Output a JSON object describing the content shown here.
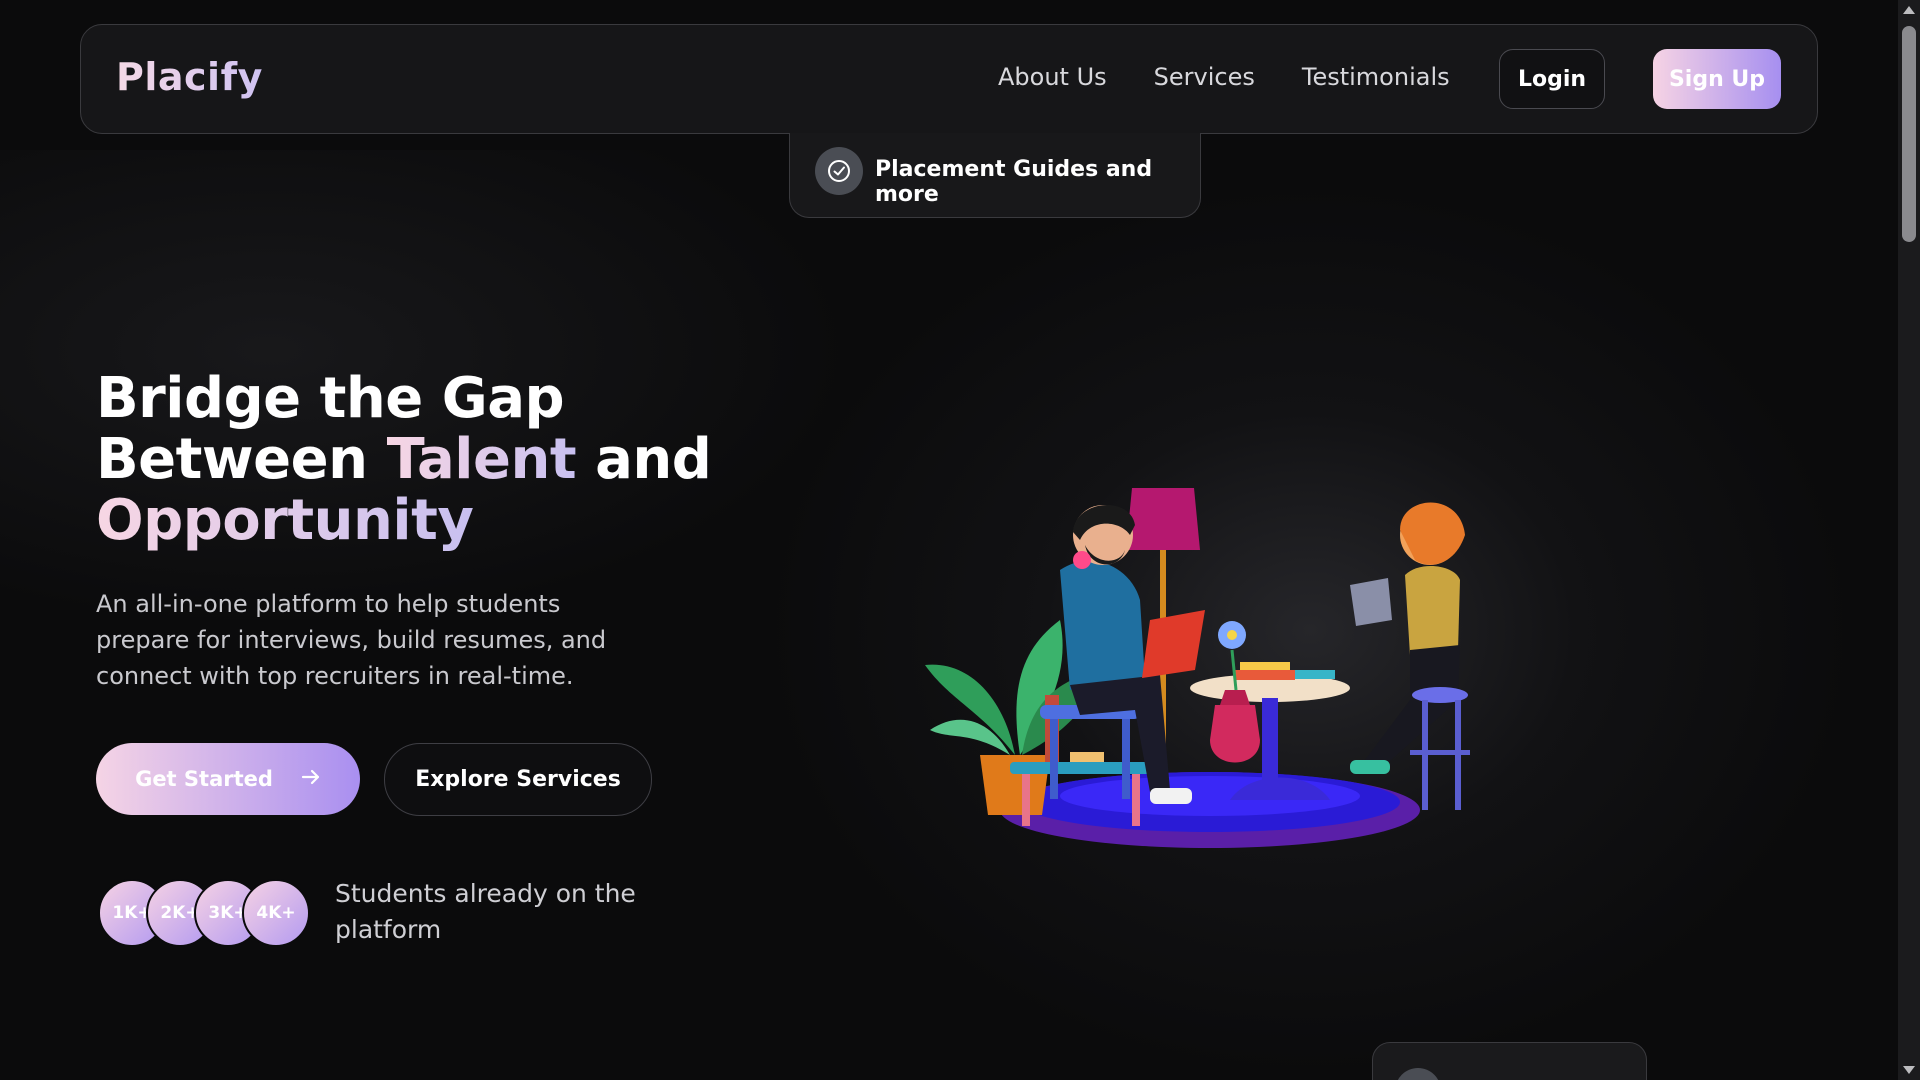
{
  "nav": {
    "brand": "Placify",
    "links": [
      "About Us",
      "Services",
      "Testimonials"
    ],
    "login_label": "Login",
    "signup_label": "Sign Up"
  },
  "badge": {
    "icon": "check-circle-icon",
    "text": "Placement Guides and more"
  },
  "hero": {
    "title_line1": "Bridge the Gap",
    "title_line2_part1": "Between ",
    "title_line2_highlight": "Talent",
    "title_line2_part2": " and",
    "title_line3_highlight": "Opportunity",
    "description": "An all-in-one platform to help students prepare for interviews, build resumes, and connect with top recruiters in real-time.",
    "primary_cta": "Get Started",
    "primary_cta_icon": "arrow-right-icon",
    "secondary_cta": "Explore Services"
  },
  "stats": {
    "avatars": [
      "1K+",
      "2K+",
      "3K+",
      "4K+"
    ],
    "caption": "Students already on the platform"
  },
  "colors": {
    "background": "#0b0b0c",
    "gradient_start": "#f6d3e4",
    "gradient_end": "#a68ff0"
  }
}
